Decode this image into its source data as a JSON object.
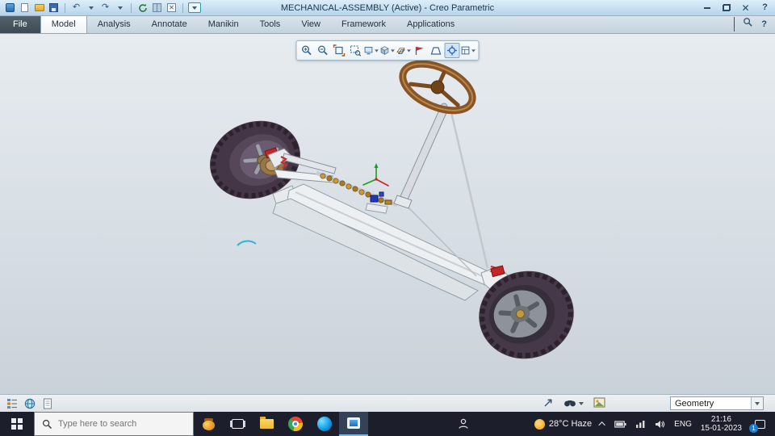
{
  "title_bar": {
    "title": "MECHANICAL-ASSEMBLY (Active) - Creo Parametric",
    "quick_access_icons": [
      "app-icon",
      "new-file-icon",
      "open-file-icon",
      "save-icon",
      "undo-icon",
      "redo-icon",
      "regenerate-icon",
      "window-grid-icon",
      "close-window-icon",
      "customize-dropdown-icon"
    ],
    "window_control_icons": [
      "minimize-icon",
      "restore-icon",
      "close-icon",
      "help-icon"
    ]
  },
  "ribbon": {
    "tabs": [
      {
        "label": "File"
      },
      {
        "label": "Model"
      },
      {
        "label": "Analysis"
      },
      {
        "label": "Annotate"
      },
      {
        "label": "Manikin"
      },
      {
        "label": "Tools"
      },
      {
        "label": "View"
      },
      {
        "label": "Framework"
      },
      {
        "label": "Applications"
      }
    ],
    "active_tab": "Model",
    "right_icons": [
      "collapse-ribbon-icon",
      "command-search-icon",
      "help-icon"
    ]
  },
  "graphics_toolbar": {
    "icons": [
      "zoom-in-icon",
      "zoom-out-icon",
      "refit-icon",
      "zoom-window-icon",
      "named-views-icon",
      "display-style-icon",
      "datum-display-icon",
      "annotation-display-icon",
      "perspective-icon",
      "spin-center-icon",
      "view-manager-icon"
    ]
  },
  "status_bar": {
    "left_icons": [
      "model-tree-icon",
      "web-browser-icon",
      "page-icon"
    ],
    "right_icons": [
      "select-arrow-icon",
      "search-tool-icon",
      "select-preview-icon"
    ],
    "filter_label": "Geometry"
  },
  "taskbar": {
    "search_placeholder": "Type here to search",
    "app_icons": [
      "start-icon",
      "honey-app-icon",
      "task-view-icon",
      "file-explorer-icon",
      "chrome-icon",
      "edge-icon",
      "active-app-icon",
      "people-icon"
    ],
    "tray": {
      "weather": "28°C Haze",
      "language": "ENG",
      "time": "21:16",
      "date": "15-01-2023",
      "notification_count": "1",
      "tray_icons": [
        "hidden-icons-chevron",
        "battery-icon",
        "network-icon",
        "volume-icon",
        "action-center-icon"
      ]
    }
  }
}
